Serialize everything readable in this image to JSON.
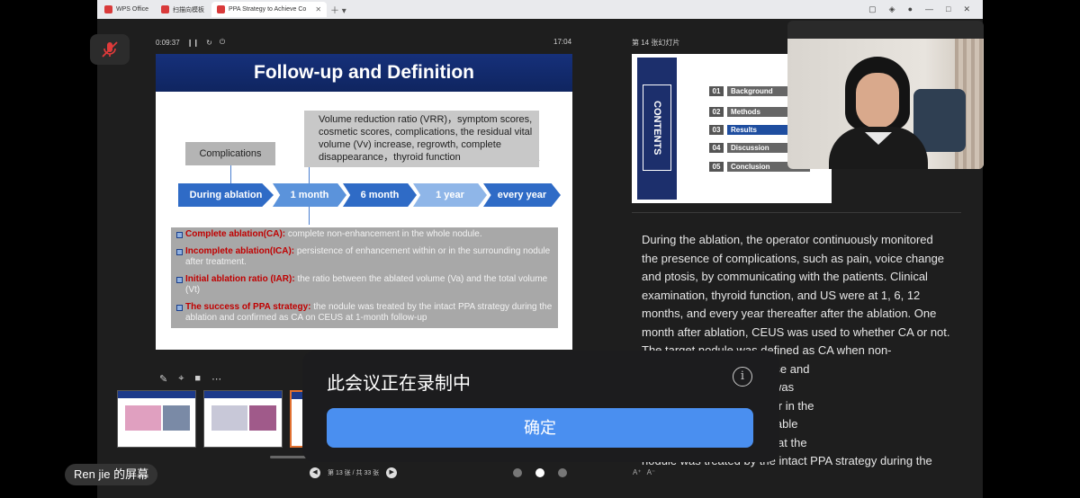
{
  "browser": {
    "tabs": [
      {
        "label": "WPS Office",
        "color": "#d93a3a"
      },
      {
        "label": "扫描向模板",
        "color": "#d93a3a"
      },
      {
        "label": "PPA Strategy to Achieve Co",
        "color": "#d93a3a",
        "active": true
      }
    ]
  },
  "presenter": {
    "elapsed": "0:09:37",
    "clock": "17:04",
    "next_label": "第 14 张幻灯片",
    "page_indicator": "第 13 张 / 共 33 张",
    "font_controls": [
      "A⁺",
      "A⁻"
    ]
  },
  "slide": {
    "title": "Follow-up and Definition",
    "complications": "Complications",
    "callout": "Volume reduction ratio (VRR)，symptom scores, cosmetic scores, complications, the residual vital volume (Vv) increase, regrowth, complete disappearance，thyroid function",
    "timeline": [
      {
        "label": "During ablation",
        "color": "#2f6bc6"
      },
      {
        "label": "1 month",
        "color": "#5b93db"
      },
      {
        "label": "6 month",
        "color": "#2f6bc6"
      },
      {
        "label": "1 year",
        "color": "#8fb6e8"
      },
      {
        "label": "every year",
        "color": "#2f6bc6"
      }
    ],
    "definitions": [
      {
        "term": "Complete ablation(CA):",
        "text": " complete non-enhancement in the whole nodule."
      },
      {
        "term": "Incomplete ablation(ICA):",
        "text": " persistence of enhancement within or in the surrounding nodule after treatment."
      },
      {
        "term": "Initial ablation ratio (IAR):",
        "text": "  the ratio between the ablated volume (Va) and the total volume (Vt)"
      },
      {
        "term": "The success of PPA strategy:",
        "text": " the nodule was treated by the intact PPA strategy during the ablation and confirmed as CA on CEUS at 1-month follow-up"
      }
    ]
  },
  "next_slide": {
    "banner": "CONTENTS",
    "items": [
      {
        "num": "01",
        "label": "Background"
      },
      {
        "num": "02",
        "label": "Methods"
      },
      {
        "num": "03",
        "label": "Results",
        "current": true
      },
      {
        "num": "04",
        "label": "Discussion"
      },
      {
        "num": "05",
        "label": "Conclusion"
      }
    ]
  },
  "notes": "During the ablation, the operator continuously monitored\nthe presence of complications, such as pain, voice change\nand ptosis, by communicating with the patients. Clinical\nexamination, thyroid function, and US were at 1, 6, 12\nmonths, and every year thereafter after the ablation. One\nmonth after ablation, CEUS was used to whether CA or not.\nThe target nodule was defined as CA when non-\n                          ed in both the arterial phase and\n                              incomplete ablation(ICA) was\n                              e of enhancement within or in the\n                              h was a sign of residual viable\n                              strategy was defined as that the\nnodule was treated by the intact PPA strategy during the",
  "share_label": "Ren jie 的屏幕",
  "dialog": {
    "title": "此会议正在录制中",
    "info": "i",
    "confirm": "确定"
  }
}
